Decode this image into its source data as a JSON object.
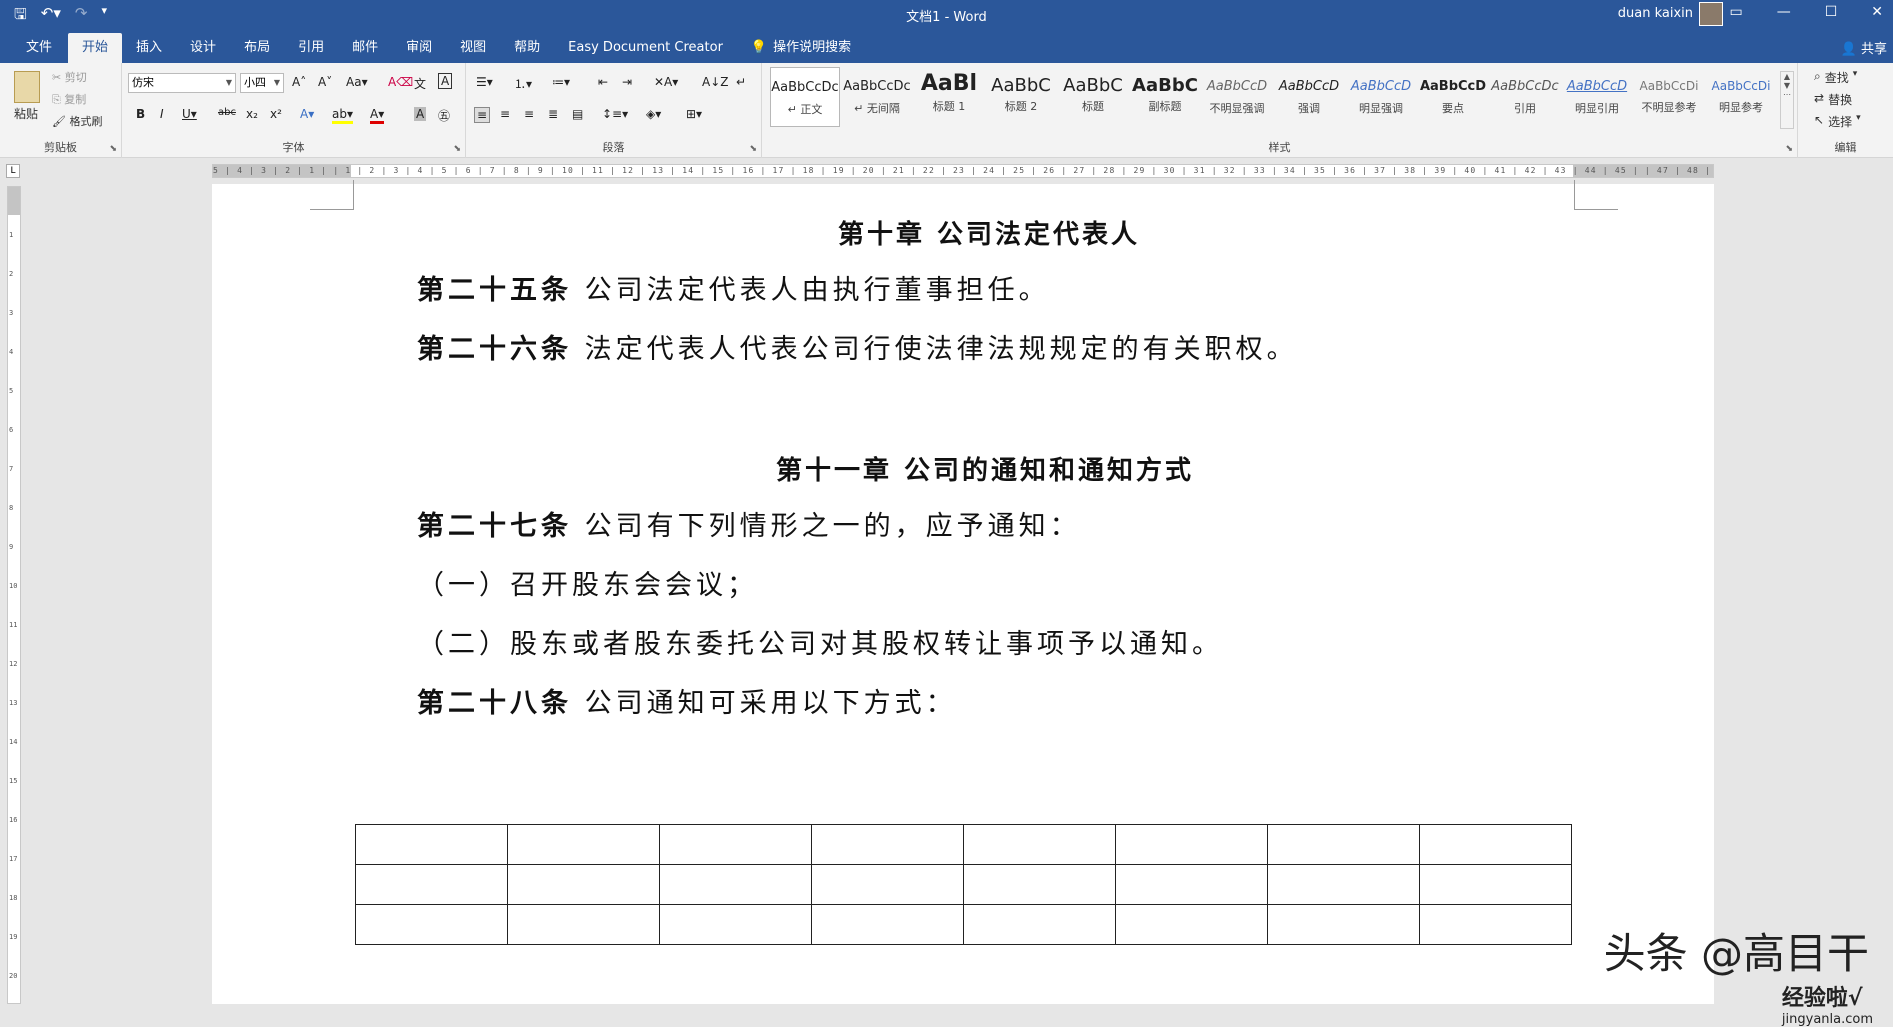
{
  "titlebar": {
    "title": "文档1  -  Word",
    "user": "duan kaixin",
    "qat": [
      "save-icon",
      "undo-icon",
      "redo-icon",
      "customize-icon"
    ]
  },
  "tabs": [
    "文件",
    "开始",
    "插入",
    "设计",
    "布局",
    "引用",
    "邮件",
    "审阅",
    "视图",
    "帮助",
    "Easy Document Creator"
  ],
  "active_tab": "开始",
  "tell_me": "操作说明搜索",
  "share": "共享",
  "ribbon": {
    "clipboard": {
      "label": "剪贴板",
      "paste": "粘贴",
      "cut": "剪切",
      "copy": "复制",
      "format_painter": "格式刷"
    },
    "font": {
      "label": "字体",
      "font_name": "仿宋",
      "font_size": "小四"
    },
    "paragraph": {
      "label": "段落"
    },
    "styles": {
      "label": "样式",
      "items": [
        {
          "sample": "AaBbCcDc",
          "name": "↵ 正文"
        },
        {
          "sample": "AaBbCcDc",
          "name": "↵ 无间隔"
        },
        {
          "sample": "AaBl",
          "name": "标题 1"
        },
        {
          "sample": "AaBbC",
          "name": "标题 2"
        },
        {
          "sample": "AaBbC",
          "name": "标题"
        },
        {
          "sample": "AaBbC",
          "name": "副标题"
        },
        {
          "sample": "AaBbCcD",
          "name": "不明显强调"
        },
        {
          "sample": "AaBbCcD",
          "name": "强调"
        },
        {
          "sample": "AaBbCcD",
          "name": "明显强调"
        },
        {
          "sample": "AaBbCcD",
          "name": "要点"
        },
        {
          "sample": "AaBbCcDc",
          "name": "引用"
        },
        {
          "sample": "AaBbCcD",
          "name": "明显引用"
        },
        {
          "sample": "AaBbCcDi",
          "name": "不明显参考"
        },
        {
          "sample": "AaBbCcDi",
          "name": "明显参考"
        }
      ]
    },
    "editing": {
      "label": "编辑",
      "find": "查找",
      "replace": "替换",
      "select": "选择"
    }
  },
  "ruler": {
    "top": "5 | 4 | 3 | 2 | 1 |   | 1 | 2 | 3 | 4 | 5 | 6 | 7 | 8 | 9 | 10 | 11 | 12 | 13 | 14 | 15 | 16 | 17 | 18 | 19 | 20 | 21 | 22 | 23 | 24 | 25 | 26 | 27 | 28 | 29 | 30 | 31 | 32 | 33 | 34 | 35 | 36 | 37 | 38 | 39 | 40 | 41 | 42 | 43 | 44 | 45 |   | 47 | 48 | 49 | 50 | 51",
    "side": [
      "1",
      "2",
      "3",
      "4",
      "5",
      "6",
      "7",
      "8",
      "9",
      "10",
      "11",
      "12",
      "13",
      "14",
      "15",
      "16",
      "17",
      "18",
      "19",
      "20"
    ]
  },
  "document": {
    "chapter10": "第十章  公司法定代表人",
    "art25_head": "第二十五条",
    "art25_body": " 公司法定代表人由执行董事担任。",
    "art26_head": "第二十六条",
    "art26_body": " 法定代表人代表公司行使法律法规规定的有关职权。",
    "chapter11": "第十一章  公司的通知和通知方式",
    "art27_head": "第二十七条",
    "art27_body": " 公司有下列情形之一的，应予通知：",
    "item1": "（一）召开股东会会议；",
    "item2": "（二）股东或者股东委托公司对其股权转让事项予以通知。",
    "art28_head": "第二十八条",
    "art28_body": " 公司通知可采用以下方式：",
    "table": {
      "rows": 3,
      "cols": 8
    }
  },
  "watermark": {
    "main": "头条 @高目干",
    "sub": "jingyanla.com",
    "brand": "经验啦√"
  }
}
